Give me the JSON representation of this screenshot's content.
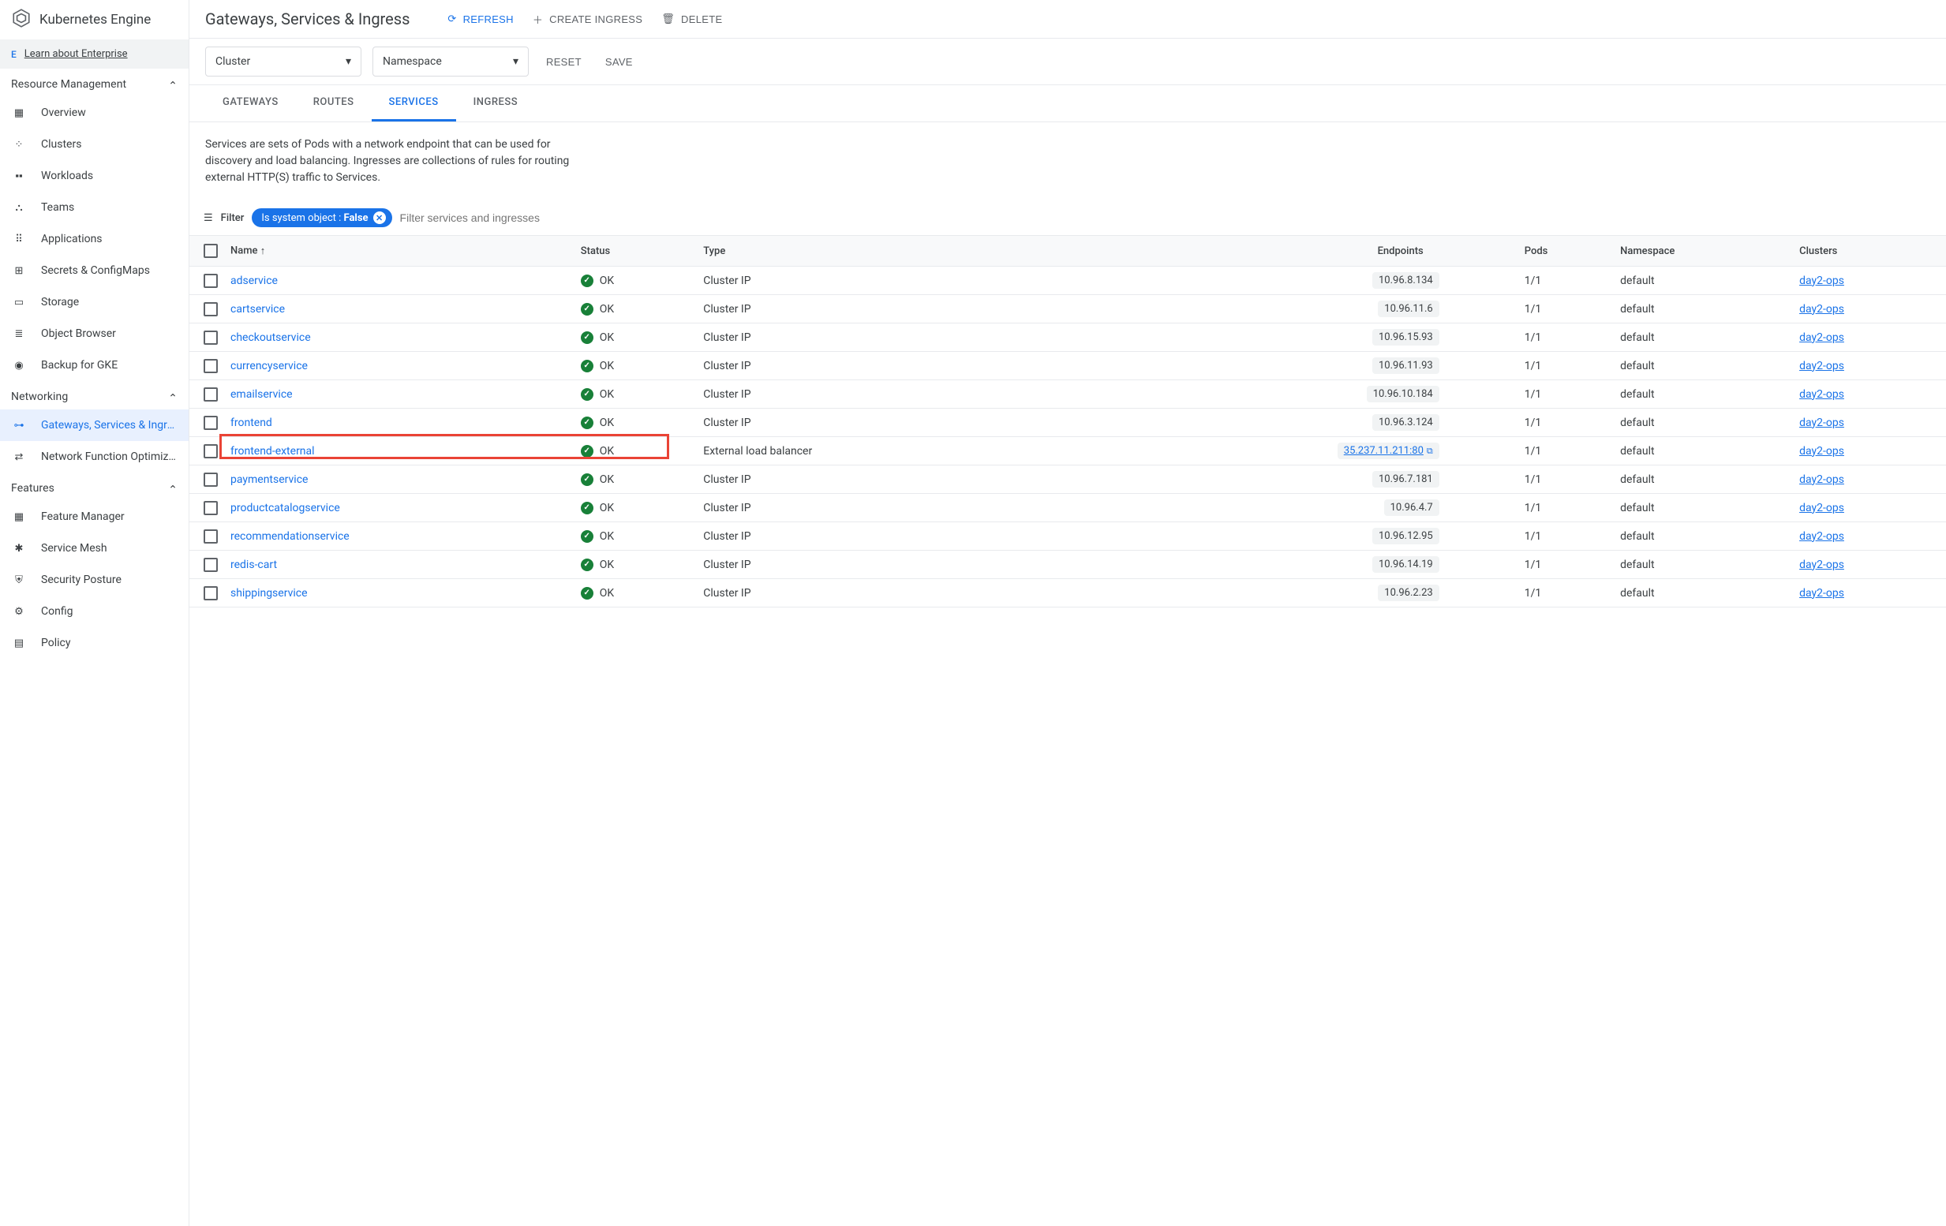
{
  "sidebar": {
    "title": "Kubernetes Engine",
    "enterprise_badge": "E",
    "enterprise_link": "Learn about Enterprise",
    "sections": {
      "resource_mgmt": {
        "label": "Resource Management"
      },
      "networking": {
        "label": "Networking"
      },
      "features": {
        "label": "Features"
      }
    },
    "items": {
      "overview": "Overview",
      "clusters": "Clusters",
      "workloads": "Workloads",
      "teams": "Teams",
      "applications": "Applications",
      "secrets": "Secrets & ConfigMaps",
      "storage": "Storage",
      "object_browser": "Object Browser",
      "backup": "Backup for GKE",
      "gateways": "Gateways, Services & Ingre…",
      "netfunc": "Network Function Optimiz…",
      "feature_mgr": "Feature Manager",
      "service_mesh": "Service Mesh",
      "security": "Security Posture",
      "config": "Config",
      "policy": "Policy"
    }
  },
  "header": {
    "title": "Gateways, Services & Ingress",
    "refresh": "REFRESH",
    "create": "CREATE INGRESS",
    "delete": "DELETE"
  },
  "filters": {
    "cluster": "Cluster",
    "namespace": "Namespace",
    "reset": "RESET",
    "save": "SAVE"
  },
  "tabs": {
    "gateways": "GATEWAYS",
    "routes": "ROUTES",
    "services": "SERVICES",
    "ingress": "INGRESS"
  },
  "description": "Services are sets of Pods with a network endpoint that can be used for discovery and load balancing. Ingresses are collections of rules for routing external HTTP(S) traffic to Services.",
  "filter_row": {
    "label": "Filter",
    "chip_key": "Is system object : ",
    "chip_val": "False",
    "placeholder": "Filter services and ingresses"
  },
  "table": {
    "headers": {
      "name": "Name",
      "status": "Status",
      "type": "Type",
      "endpoints": "Endpoints",
      "pods": "Pods",
      "namespace": "Namespace",
      "clusters": "Clusters"
    },
    "rows": [
      {
        "name": "adservice",
        "status": "OK",
        "type": "Cluster IP",
        "endpoint": "10.96.8.134",
        "pods": "1/1",
        "namespace": "default",
        "cluster": "day2-ops",
        "ext": false
      },
      {
        "name": "cartservice",
        "status": "OK",
        "type": "Cluster IP",
        "endpoint": "10.96.11.6",
        "pods": "1/1",
        "namespace": "default",
        "cluster": "day2-ops",
        "ext": false
      },
      {
        "name": "checkoutservice",
        "status": "OK",
        "type": "Cluster IP",
        "endpoint": "10.96.15.93",
        "pods": "1/1",
        "namespace": "default",
        "cluster": "day2-ops",
        "ext": false
      },
      {
        "name": "currencyservice",
        "status": "OK",
        "type": "Cluster IP",
        "endpoint": "10.96.11.93",
        "pods": "1/1",
        "namespace": "default",
        "cluster": "day2-ops",
        "ext": false
      },
      {
        "name": "emailservice",
        "status": "OK",
        "type": "Cluster IP",
        "endpoint": "10.96.10.184",
        "pods": "1/1",
        "namespace": "default",
        "cluster": "day2-ops",
        "ext": false
      },
      {
        "name": "frontend",
        "status": "OK",
        "type": "Cluster IP",
        "endpoint": "10.96.3.124",
        "pods": "1/1",
        "namespace": "default",
        "cluster": "day2-ops",
        "ext": false
      },
      {
        "name": "frontend-external",
        "status": "OK",
        "type": "External load balancer",
        "endpoint": "35.237.11.211:80",
        "pods": "1/1",
        "namespace": "default",
        "cluster": "day2-ops",
        "ext": true,
        "highlight": true
      },
      {
        "name": "paymentservice",
        "status": "OK",
        "type": "Cluster IP",
        "endpoint": "10.96.7.181",
        "pods": "1/1",
        "namespace": "default",
        "cluster": "day2-ops",
        "ext": false
      },
      {
        "name": "productcatalogservice",
        "status": "OK",
        "type": "Cluster IP",
        "endpoint": "10.96.4.7",
        "pods": "1/1",
        "namespace": "default",
        "cluster": "day2-ops",
        "ext": false
      },
      {
        "name": "recommendationservice",
        "status": "OK",
        "type": "Cluster IP",
        "endpoint": "10.96.12.95",
        "pods": "1/1",
        "namespace": "default",
        "cluster": "day2-ops",
        "ext": false
      },
      {
        "name": "redis-cart",
        "status": "OK",
        "type": "Cluster IP",
        "endpoint": "10.96.14.19",
        "pods": "1/1",
        "namespace": "default",
        "cluster": "day2-ops",
        "ext": false
      },
      {
        "name": "shippingservice",
        "status": "OK",
        "type": "Cluster IP",
        "endpoint": "10.96.2.23",
        "pods": "1/1",
        "namespace": "default",
        "cluster": "day2-ops",
        "ext": false
      }
    ]
  }
}
